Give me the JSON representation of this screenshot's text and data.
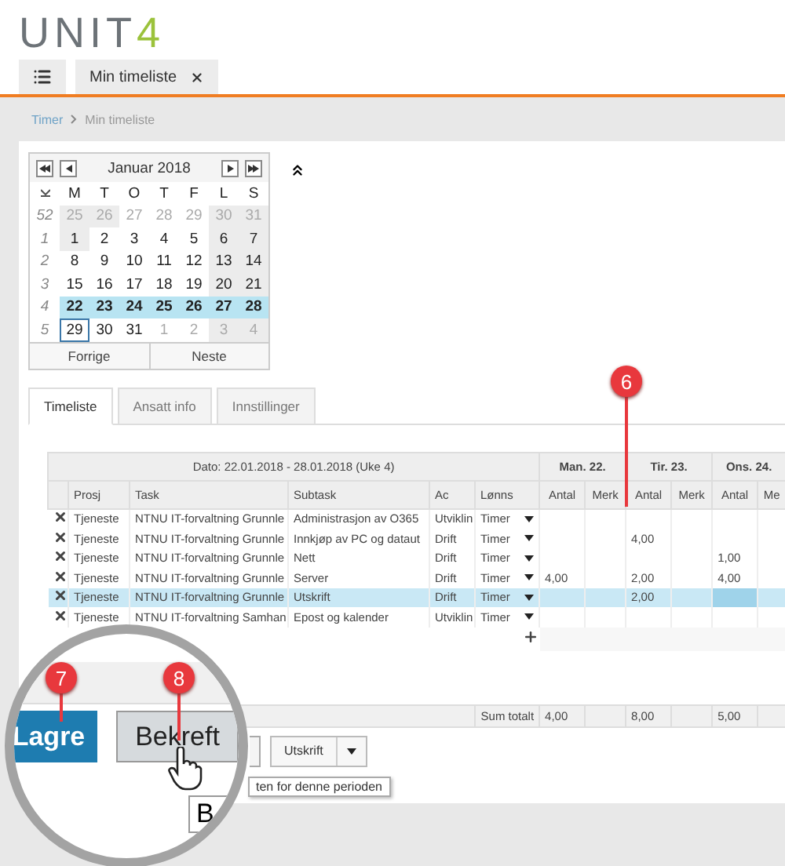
{
  "logo": {
    "text": "UNIT",
    "accent": "4"
  },
  "top_tabs": [
    {
      "kind": "menu"
    },
    {
      "kind": "page",
      "label": "Min timeliste"
    }
  ],
  "breadcrumb": [
    "Timer",
    "Min timeliste"
  ],
  "calendar": {
    "month": "Januar 2018",
    "weekday_header": [
      "M",
      "T",
      "O",
      "T",
      "F",
      "L",
      "S"
    ],
    "weeks": [
      {
        "week": "52",
        "selected": false,
        "days": [
          {
            "d": "25",
            "muted": true,
            "shaded": true,
            "today": false
          },
          {
            "d": "26",
            "muted": true,
            "shaded": true,
            "today": false
          },
          {
            "d": "27",
            "muted": true,
            "shaded": false,
            "today": false
          },
          {
            "d": "28",
            "muted": true,
            "shaded": false,
            "today": false
          },
          {
            "d": "29",
            "muted": true,
            "shaded": false,
            "today": false
          },
          {
            "d": "30",
            "muted": true,
            "shaded": true,
            "today": false
          },
          {
            "d": "31",
            "muted": true,
            "shaded": true,
            "today": false
          }
        ]
      },
      {
        "week": "1",
        "selected": false,
        "days": [
          {
            "d": "1",
            "muted": false,
            "shaded": true,
            "today": false
          },
          {
            "d": "2",
            "muted": false,
            "shaded": false,
            "today": false
          },
          {
            "d": "3",
            "muted": false,
            "shaded": false,
            "today": false
          },
          {
            "d": "4",
            "muted": false,
            "shaded": false,
            "today": false
          },
          {
            "d": "5",
            "muted": false,
            "shaded": false,
            "today": false
          },
          {
            "d": "6",
            "muted": false,
            "shaded": true,
            "today": false
          },
          {
            "d": "7",
            "muted": false,
            "shaded": true,
            "today": false
          }
        ]
      },
      {
        "week": "2",
        "selected": false,
        "days": [
          {
            "d": "8",
            "muted": false,
            "shaded": false,
            "today": false
          },
          {
            "d": "9",
            "muted": false,
            "shaded": false,
            "today": false
          },
          {
            "d": "10",
            "muted": false,
            "shaded": false,
            "today": false
          },
          {
            "d": "11",
            "muted": false,
            "shaded": false,
            "today": false
          },
          {
            "d": "12",
            "muted": false,
            "shaded": false,
            "today": false
          },
          {
            "d": "13",
            "muted": false,
            "shaded": true,
            "today": false
          },
          {
            "d": "14",
            "muted": false,
            "shaded": true,
            "today": false
          }
        ]
      },
      {
        "week": "3",
        "selected": false,
        "days": [
          {
            "d": "15",
            "muted": false,
            "shaded": false,
            "today": false
          },
          {
            "d": "16",
            "muted": false,
            "shaded": false,
            "today": false
          },
          {
            "d": "17",
            "muted": false,
            "shaded": false,
            "today": false
          },
          {
            "d": "18",
            "muted": false,
            "shaded": false,
            "today": false
          },
          {
            "d": "19",
            "muted": false,
            "shaded": false,
            "today": false
          },
          {
            "d": "20",
            "muted": false,
            "shaded": true,
            "today": false
          },
          {
            "d": "21",
            "muted": false,
            "shaded": true,
            "today": false
          }
        ]
      },
      {
        "week": "4",
        "selected": true,
        "days": [
          {
            "d": "22",
            "muted": false,
            "shaded": false,
            "today": false
          },
          {
            "d": "23",
            "muted": false,
            "shaded": false,
            "today": false
          },
          {
            "d": "24",
            "muted": false,
            "shaded": false,
            "today": false
          },
          {
            "d": "25",
            "muted": false,
            "shaded": false,
            "today": false
          },
          {
            "d": "26",
            "muted": false,
            "shaded": false,
            "today": false
          },
          {
            "d": "27",
            "muted": false,
            "shaded": true,
            "today": false
          },
          {
            "d": "28",
            "muted": false,
            "shaded": true,
            "today": false
          }
        ]
      },
      {
        "week": "5",
        "selected": false,
        "days": [
          {
            "d": "29",
            "muted": false,
            "shaded": false,
            "today": true
          },
          {
            "d": "30",
            "muted": false,
            "shaded": false,
            "today": false
          },
          {
            "d": "31",
            "muted": false,
            "shaded": false,
            "today": false
          },
          {
            "d": "1",
            "muted": true,
            "shaded": false,
            "today": false
          },
          {
            "d": "2",
            "muted": true,
            "shaded": false,
            "today": false
          },
          {
            "d": "3",
            "muted": true,
            "shaded": true,
            "today": false
          },
          {
            "d": "4",
            "muted": true,
            "shaded": true,
            "today": false
          }
        ]
      }
    ],
    "buttons": [
      "Forrige",
      "Neste"
    ]
  },
  "tabs": [
    {
      "label": "Timeliste",
      "selected": true
    },
    {
      "label": "Ansatt info",
      "selected": false
    },
    {
      "label": "Innstillinger",
      "selected": false
    }
  ],
  "grid": {
    "period": "Dato: 22.01.2018 - 28.01.2018 (Uke 4)",
    "days": [
      "Man. 22.",
      "Tir. 23.",
      "Ons. 24."
    ],
    "columns": [
      "Prosj",
      "Task",
      "Subtask",
      "Ac",
      "Lønns"
    ],
    "day_columns": [
      "Antal",
      "Merk",
      "Antal",
      "Merk",
      "Antal",
      "Me"
    ],
    "rows": [
      {
        "prosj": "Tjeneste",
        "task": "NTNU IT-forvaltning Grunnle",
        "subtask": "Administrasjon av O365",
        "ac": "Utviklin",
        "lonn": "Timer",
        "selected": false
      },
      {
        "prosj": "Tjeneste",
        "task": "NTNU IT-forvaltning Grunnle",
        "subtask": "Innkjøp av PC og dataut",
        "ac": "Drift",
        "lonn": "Timer",
        "tir": "4,00",
        "selected": false
      },
      {
        "prosj": "Tjeneste",
        "task": "NTNU IT-forvaltning Grunnle",
        "subtask": "Nett",
        "ac": "Drift",
        "lonn": "Timer",
        "ons": "1,00",
        "selected": false
      },
      {
        "prosj": "Tjeneste",
        "task": "NTNU IT-forvaltning Grunnle",
        "subtask": "Server",
        "ac": "Drift",
        "lonn": "Timer",
        "man": "4,00",
        "tir": "2,00",
        "ons": "4,00",
        "selected": false
      },
      {
        "prosj": "Tjeneste",
        "task": "NTNU IT-forvaltning Grunnle",
        "subtask": "Utskrift",
        "ac": "Drift",
        "lonn": "Timer",
        "tir": "2,00",
        "selected": true
      },
      {
        "prosj": "Tjeneste",
        "task": "NTNU IT-forvaltning Samhan",
        "subtask": "Epost og kalender",
        "ac": "Utviklin",
        "lonn": "Timer",
        "selected": false
      }
    ],
    "sum": {
      "label": "Sum totalt",
      "man": "4,00",
      "tir": "8,00",
      "ons": "5,00"
    }
  },
  "actions": {
    "print": "Utskrift",
    "tooltip": "ten for denne perioden"
  },
  "magnifier": {
    "save": "Lagre",
    "confirm": "Bekreft",
    "tooltip": "B"
  },
  "callouts": [
    "6",
    "7",
    "8"
  ]
}
